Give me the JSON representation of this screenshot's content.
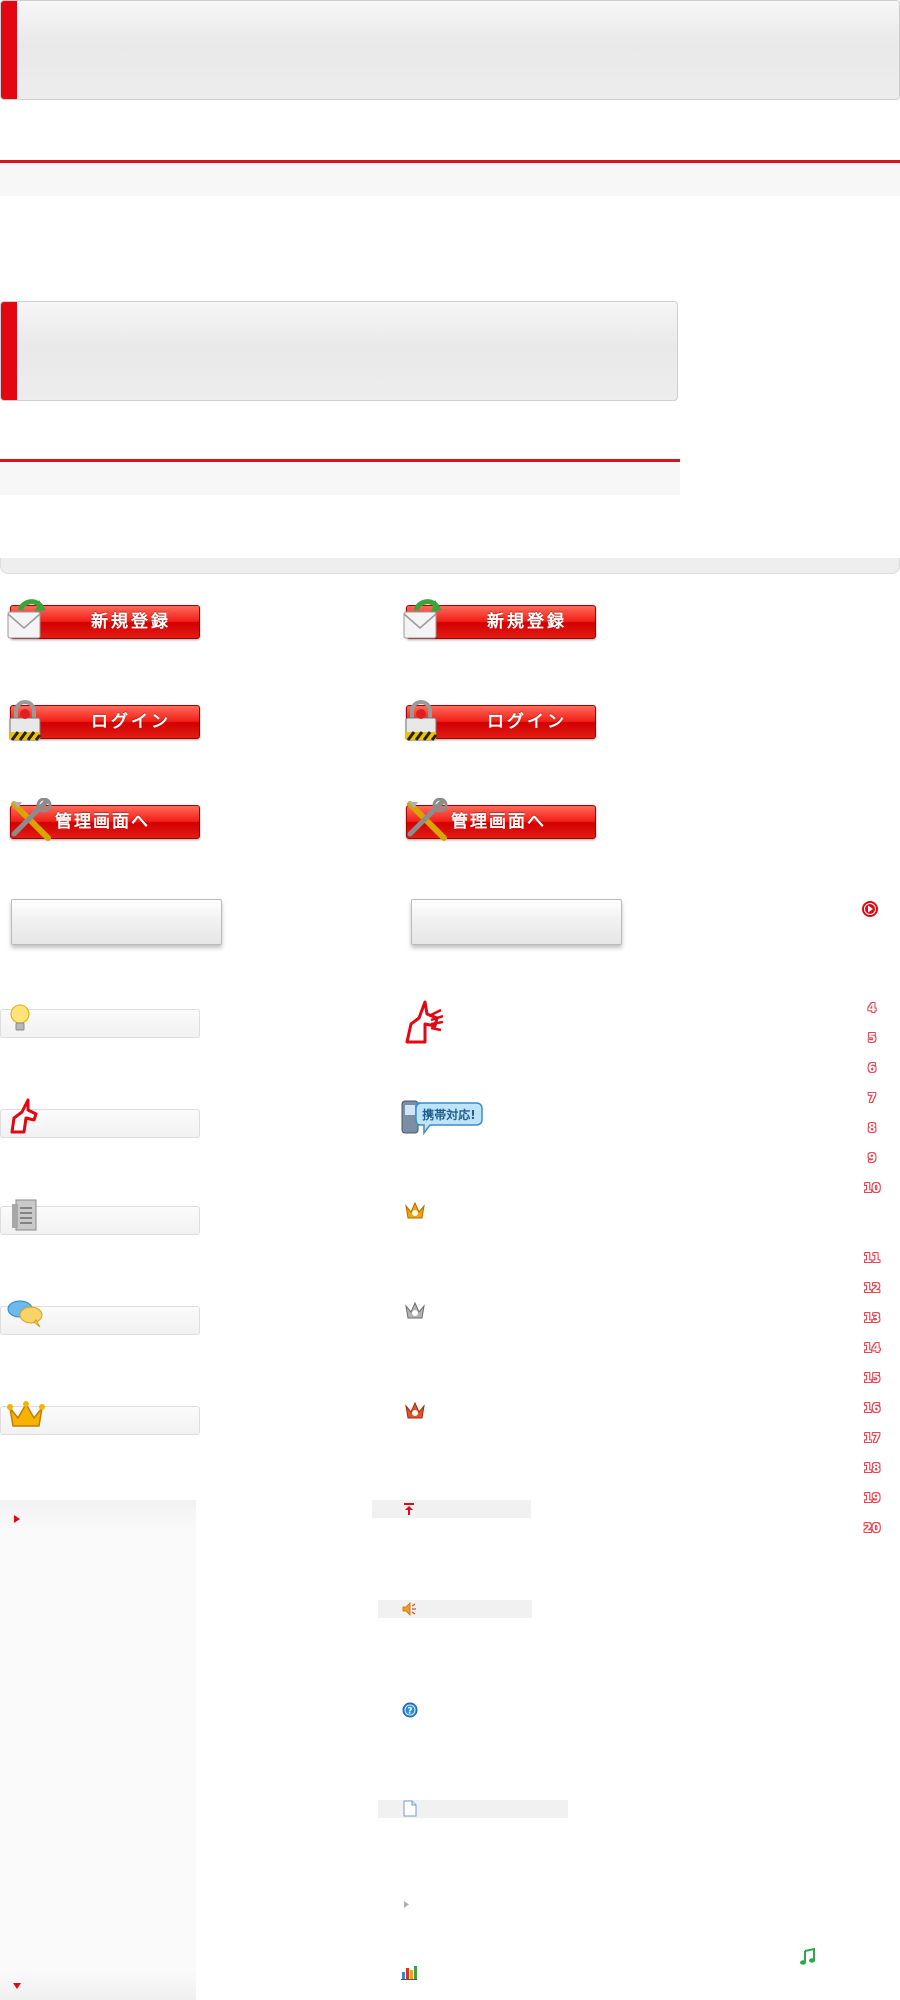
{
  "buttons": {
    "register": "新規登録",
    "login": "ログイン",
    "admin": "管理画面へ"
  },
  "badges": {
    "mobile": "携帯対応!"
  },
  "ranking_numbers": [
    "4",
    "5",
    "6",
    "7",
    "8",
    "9",
    "10",
    "11",
    "12",
    "13",
    "14",
    "15",
    "16",
    "17",
    "18",
    "19",
    "20"
  ],
  "colors": {
    "accent": "#e30613",
    "button_red": "#e31c14",
    "number_pink": "#e54653"
  },
  "icons": {
    "register": "mail-refresh-icon",
    "login": "padlock-icon",
    "admin": "tools-icon",
    "next": "circle-arrow-icon",
    "idea": "lightbulb-icon",
    "unicorn": "unicorn-icon",
    "mobile": "mobile-phone-icon",
    "document": "document-list-icon",
    "chat": "speech-bubbles-icon",
    "crown_gold": "gold-crown-icon",
    "crown_silver": "silver-crown-icon",
    "crown_bronze": "bronze-crown-icon",
    "page_top": "arrow-up-icon",
    "speaker": "speaker-icon",
    "help": "help-icon",
    "file": "page-icon",
    "bullet": "triangle-right-icon",
    "chart": "bar-chart-icon",
    "music": "music-note-icon"
  }
}
